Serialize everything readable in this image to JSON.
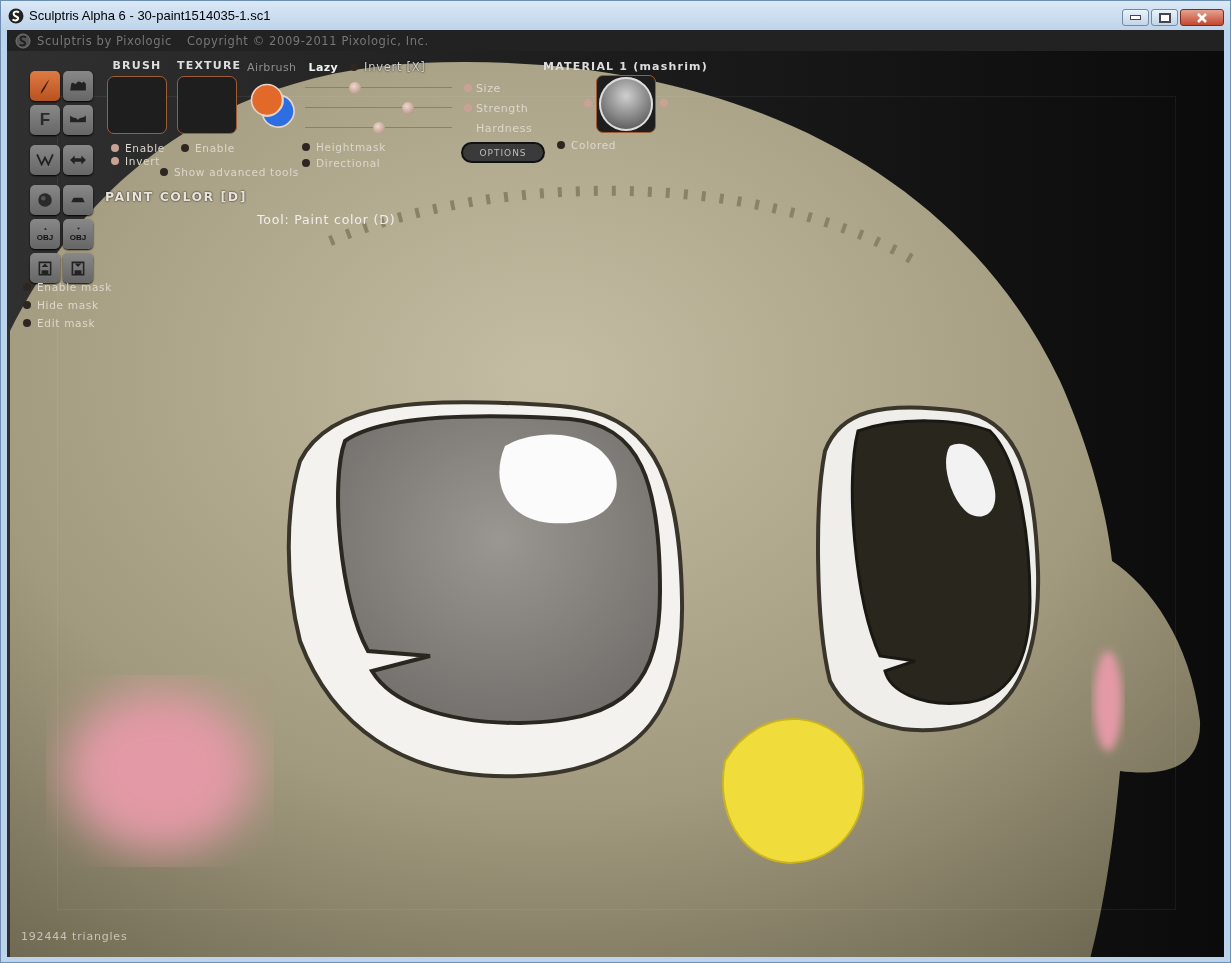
{
  "window": {
    "title": "Sculptris Alpha 6 - 30-paint1514035-1.sc1"
  },
  "header": {
    "app_name": "Sculptris by Pixologic",
    "copyright": "Copyright © 2009-2011 Pixologic, Inc."
  },
  "tools": [
    {
      "kind": "brush",
      "selected": true
    },
    {
      "kind": "bumps",
      "selected": false
    },
    {
      "kind": "letter",
      "label": "F",
      "selected": false
    },
    {
      "kind": "dents",
      "selected": false
    },
    {
      "kind": "zigzag",
      "selected": false
    },
    {
      "kind": "arrows",
      "selected": false
    },
    {
      "kind": "sphere",
      "selected": false
    },
    {
      "kind": "flat",
      "selected": false
    },
    {
      "kind": "obj_in",
      "label": "OBJ",
      "selected": false
    },
    {
      "kind": "obj_out",
      "label": "OBJ",
      "selected": false
    },
    {
      "kind": "disk_in",
      "selected": false
    },
    {
      "kind": "disk_out",
      "selected": false
    }
  ],
  "mode_label": "PAINT COLOR [D]",
  "brush": {
    "title": "BRUSH",
    "options": [
      {
        "label": "Enable",
        "on": true
      },
      {
        "label": "Invert",
        "on": true
      }
    ]
  },
  "texture": {
    "title": "TEXTURE",
    "options": [
      {
        "label": "Enable",
        "on": false
      }
    ]
  },
  "show_advanced": {
    "label": "Show advanced tools",
    "on": false
  },
  "paint_colors": [
    {
      "color": "#e2692a"
    },
    {
      "color": "#2d6fe2"
    }
  ],
  "modes": [
    {
      "label": "Airbrush",
      "on": false
    },
    {
      "label": "Lazy",
      "on": true
    }
  ],
  "invert": {
    "label": "Invert [X]",
    "on": false
  },
  "sliders": [
    {
      "label": "Size",
      "level": 0.34,
      "pressure": true
    },
    {
      "label": "Strength",
      "level": 0.7,
      "pressure": true
    },
    {
      "label": "Hardness",
      "level": 0.5
    }
  ],
  "stroke_options": [
    {
      "label": "Heightmask",
      "on": false
    },
    {
      "label": "Directional",
      "on": false
    }
  ],
  "options_button": "OPTIONS",
  "material": {
    "title": "MATERIAL 1 (mashrim)",
    "colored": {
      "label": "Colored",
      "on": false
    }
  },
  "mask_options": [
    {
      "label": "Enable mask",
      "on": false
    },
    {
      "label": "Hide mask",
      "on": false
    },
    {
      "label": "Edit mask",
      "on": false
    }
  ],
  "tool_status": "Tool: Paint color (D)",
  "triangle_count": "192444 triangles"
}
